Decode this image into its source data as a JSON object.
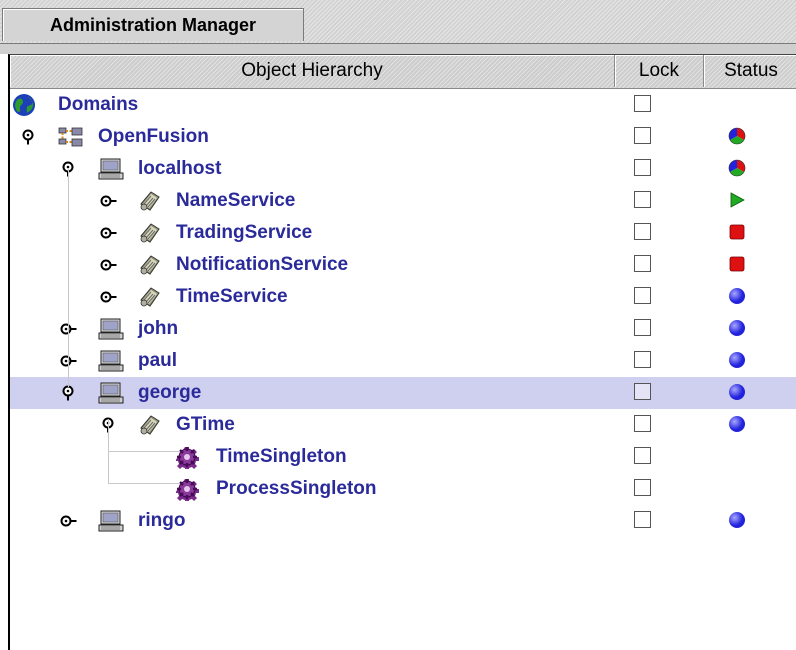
{
  "tab": {
    "label": "Administration Manager"
  },
  "header": {
    "object_hierarchy": "Object Hierarchy",
    "lock": "Lock",
    "status": "Status"
  },
  "colors": {
    "label": "#2a2a9a",
    "selected_row": "#cfcff0",
    "running": "#22aa22",
    "stopped": "#dd1111",
    "idle": "#2222dd"
  },
  "rows": [
    {
      "label": "Domains",
      "depth": 0,
      "icon": "globe-icon",
      "expander": "none",
      "lock": false,
      "status": "none"
    },
    {
      "label": "OpenFusion",
      "depth": 1,
      "icon": "network-icon",
      "expander": "expanded",
      "lock": false,
      "status": "mixed"
    },
    {
      "label": "localhost",
      "depth": 2,
      "icon": "computer-icon",
      "expander": "expanded",
      "lock": false,
      "status": "mixed"
    },
    {
      "label": "NameService",
      "depth": 3,
      "icon": "service-icon",
      "expander": "collapsed",
      "lock": false,
      "status": "running"
    },
    {
      "label": "TradingService",
      "depth": 3,
      "icon": "service-icon",
      "expander": "collapsed",
      "lock": false,
      "status": "stopped"
    },
    {
      "label": "NotificationService",
      "depth": 3,
      "icon": "service-icon",
      "expander": "collapsed",
      "lock": false,
      "status": "stopped"
    },
    {
      "label": "TimeService",
      "depth": 3,
      "icon": "service-icon",
      "expander": "collapsed",
      "lock": false,
      "status": "idle"
    },
    {
      "label": "john",
      "depth": 2,
      "icon": "computer-icon",
      "expander": "collapsed",
      "lock": false,
      "status": "idle"
    },
    {
      "label": "paul",
      "depth": 2,
      "icon": "computer-icon",
      "expander": "collapsed",
      "lock": false,
      "status": "idle"
    },
    {
      "label": "george",
      "depth": 2,
      "icon": "computer-icon",
      "expander": "expanded",
      "lock": false,
      "status": "idle",
      "selected": true
    },
    {
      "label": "GTime",
      "depth": 3,
      "icon": "service-icon",
      "expander": "expanded",
      "lock": false,
      "status": "idle"
    },
    {
      "label": "TimeSingleton",
      "depth": 4,
      "icon": "gear-icon",
      "expander": "none",
      "lock": false,
      "status": "none"
    },
    {
      "label": "ProcessSingleton",
      "depth": 4,
      "icon": "gear-icon",
      "expander": "none",
      "lock": false,
      "status": "none"
    },
    {
      "label": "ringo",
      "depth": 2,
      "icon": "computer-icon",
      "expander": "collapsed",
      "lock": false,
      "status": "idle"
    }
  ]
}
